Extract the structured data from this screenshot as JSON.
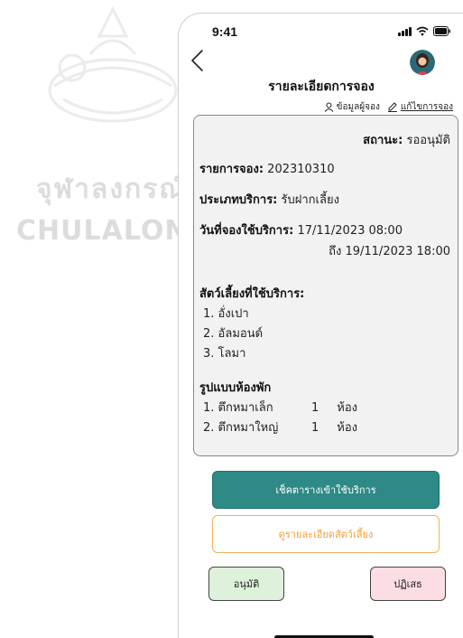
{
  "watermark": {
    "thai": "จุฬาลงกรณ์",
    "english": "CHULALONGKORN"
  },
  "status_bar": {
    "time": "9:41"
  },
  "header": {
    "title": "รายละเอียดการจอง",
    "booker_info_label": "ข้อมูลผู้จอง",
    "edit_booking_label": "แก้ไขการจอง"
  },
  "booking": {
    "status_label": "สถานะ:",
    "status_value": "รออนุมัติ",
    "booking_id_label": "รายการจอง:",
    "booking_id_value": "202310310",
    "service_type_label": "ประเภทบริการ:",
    "service_type_value": "รับฝากเลี้ยง",
    "service_date_label": "วันที่จองใช้บริการ:",
    "service_date_from": "17/11/2023 08:00",
    "service_date_to_label": "ถึง",
    "service_date_to": "19/11/2023 18:00",
    "pets_label": "สัตว์เลี้ยงที่ใช้บริการ:",
    "pets": [
      {
        "index": "1.",
        "name": "อั่งเปา"
      },
      {
        "index": "2.",
        "name": "อัลมอนด์"
      },
      {
        "index": "3.",
        "name": "โลมา"
      }
    ],
    "rooms_label": "รูปแบบห้องพัก",
    "rooms": [
      {
        "index": "1.",
        "name": "ตึกหมาเล็ก",
        "qty": "1",
        "unit": "ห้อง"
      },
      {
        "index": "2.",
        "name": "ตึกหมาใหญ่",
        "qty": "1",
        "unit": "ห้อง"
      }
    ]
  },
  "buttons": {
    "check_schedule": "เช็คตารางเข้าใช้บริการ",
    "view_pet_details": "ดูรายละเอียดสัตว์เลี้ยง",
    "approve": "อนุมัติ",
    "reject": "ปฏิเสธ"
  },
  "colors": {
    "primary_teal": "#2e8a86",
    "orange_accent": "#f0a03e",
    "approve_bg": "#def2db",
    "reject_bg": "#fbdde3",
    "card_bg": "#f2f2f2"
  },
  "icons": [
    "back-chevron-icon",
    "avatar-icon",
    "signal-icon",
    "wifi-icon",
    "battery-icon",
    "person-icon",
    "pencil-icon"
  ]
}
